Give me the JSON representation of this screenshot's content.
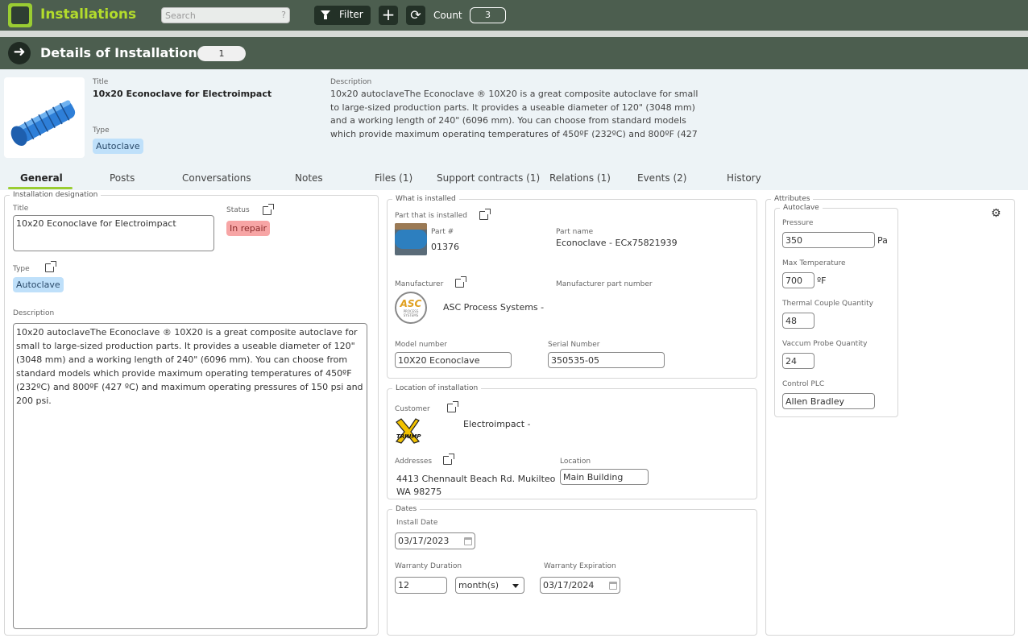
{
  "app": {
    "title": "Installations"
  },
  "toolbar": {
    "search_placeholder": "Search",
    "search_hint": "?",
    "filter_label": "Filter",
    "add_symbol": "+",
    "refresh_symbol": "⟳",
    "count_label": "Count",
    "count_value": "3"
  },
  "details": {
    "title": "Details of Installation",
    "number": "1",
    "back_symbol": "➜"
  },
  "summary": {
    "title_label": "Title",
    "title": "10x20 Econoclave for Electroimpact",
    "type_label": "Type",
    "type": "Autoclave",
    "description_label": "Description",
    "description": "10x20 autoclaveThe Econoclave ® 10X20 is a great composite autoclave for small to large-sized production parts.   It provides a useable diameter of 120\" (3048 mm) and a working length of 240\" (6096 mm). You can choose from standard models which provide maximum operating temperatures of 450ºF (232ºC) and 800ºF (427"
  },
  "tabs": [
    {
      "label": "General"
    },
    {
      "label": "Posts"
    },
    {
      "label": "Conversations"
    },
    {
      "label": "Notes"
    },
    {
      "label": "Files (1)"
    },
    {
      "label": "Support contracts (1)"
    },
    {
      "label": "Relations (1)"
    },
    {
      "label": "Events (2)"
    },
    {
      "label": "History"
    }
  ],
  "designation": {
    "legend": "Installation designation",
    "title_label": "Title",
    "title_value": "10x20 Econoclave for Electroimpact",
    "status_label": "Status",
    "status_value": "In repair",
    "type_label": "Type",
    "type_value": "Autoclave",
    "description_label": "Description",
    "description_value": "10x20 autoclaveThe Econoclave ® 10X20 is a great composite autoclave for small to large-sized production parts.   It provides a useable diameter of 120\" (3048 mm) and a working length of 240\" (6096 mm). You can choose from standard models which provide maximum operating temperatures of 450ºF (232ºC) and 800ºF (427 ºC) and maximum operating pressures of 150 psi and 200 psi."
  },
  "installed": {
    "legend": "What is installed",
    "part_label": "Part that is installed",
    "part_no_label": "Part #",
    "part_no": "01376",
    "part_name_label": "Part name",
    "part_name": "Econoclave - ECx75821939",
    "manufacturer_label": "Manufacturer",
    "manufacturer": "ASC Process Systems -",
    "manufacturer_logo_text": "ASC",
    "manufacturer_logo_sub": "PROCESS SYSTEMS",
    "mfr_part_label": "Manufacturer part number",
    "model_label": "Model number",
    "model": "10X20 Econoclave",
    "serial_label": "Serial Number",
    "serial": "350535-05"
  },
  "location": {
    "legend": "Location of installation",
    "customer_label": "Customer",
    "customer": "Electroimpact -",
    "customer_logo_text": "TRIUMP",
    "addresses_label": "Addresses",
    "address": "4413 Chennault Beach Rd. Mukilteo WA 98275",
    "location_label": "Location",
    "location_value": "Main Building"
  },
  "dates": {
    "legend": "Dates",
    "install_label": "Install Date",
    "install_date": "03/17/2023",
    "warranty_duration_label": "Warranty Duration",
    "warranty_duration": "12",
    "warranty_unit": "month(s)",
    "warranty_expiration_label": "Warranty Expiration",
    "warranty_expiration": "03/17/2024"
  },
  "attributes": {
    "legend": "Attributes",
    "group_legend": "Autoclave",
    "pressure_label": "Pressure",
    "pressure": "350",
    "pressure_unit": "Pa",
    "max_temp_label": "Max Temperature",
    "max_temp": "700",
    "max_temp_unit": "ºF",
    "thermal_label": "Thermal Couple Quantity",
    "thermal": "48",
    "vaccum_label": "Vaccum Probe Quantity",
    "vaccum": "24",
    "plc_label": "Control PLC",
    "plc": "Allen Bradley"
  },
  "colors": {
    "header_bg": "#4c5e4f",
    "accent": "#b3dc2c",
    "status_red": "#f7a5a5",
    "type_blue": "#bfe0fa"
  }
}
